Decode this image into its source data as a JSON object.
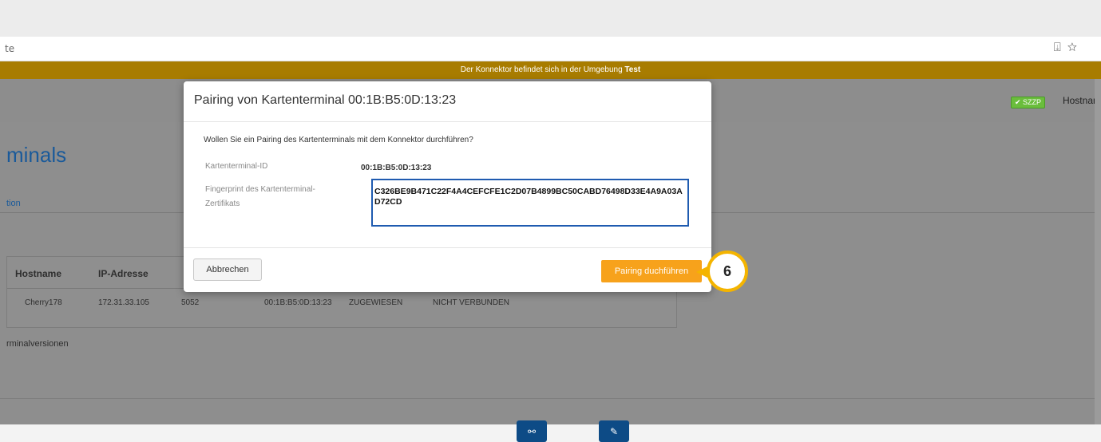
{
  "browser": {
    "address_text": "te",
    "icons": [
      "download-page-icon",
      "star-bookmark-icon"
    ]
  },
  "env_banner": {
    "prefix": "Der Konnektor befindet sich in der Umgebung ",
    "env": "Test"
  },
  "header": {
    "badge": "✔ SZZP",
    "hostname_label": "Hostnam"
  },
  "page": {
    "title": "minals",
    "tab_link": "tion",
    "terminalversions_link": "rminalversionen"
  },
  "table": {
    "headers": [
      "Hostname",
      "IP-Adresse"
    ],
    "row": [
      "Cherry178",
      "172.31.33.105",
      "5052",
      "00:1B:B5:0D:13:23",
      "ZUGEWIESEN",
      "NICHT VERBUNDEN"
    ]
  },
  "modal": {
    "title": "Pairing von Kartenterminal 00:1B:B5:0D:13:23",
    "question": "Wollen Sie ein Pairing des Kartenterminals mit dem Konnektor durchführen?",
    "terminal_id_label": "Kartenterminal-ID",
    "terminal_id_value": "00:1B:B5:0D:13:23",
    "fingerprint_label": "Fingerprint des Kartenterminal-Zertifikats",
    "fingerprint_value": "C326BE9B471C22F4A4CEFCFE1C2D07B4899BC50CABD76498D33E4A9A03AD72CD",
    "cancel_label": "Abbrechen",
    "pair_label": "Pairing duchführen"
  },
  "callout": {
    "step": "6",
    "color": "#f4b400"
  },
  "colors": {
    "banner": "#a87c00",
    "primary_button": "#f7a21b",
    "icon_button": "#0d4b86",
    "focus_border": "#1f5bb0"
  }
}
